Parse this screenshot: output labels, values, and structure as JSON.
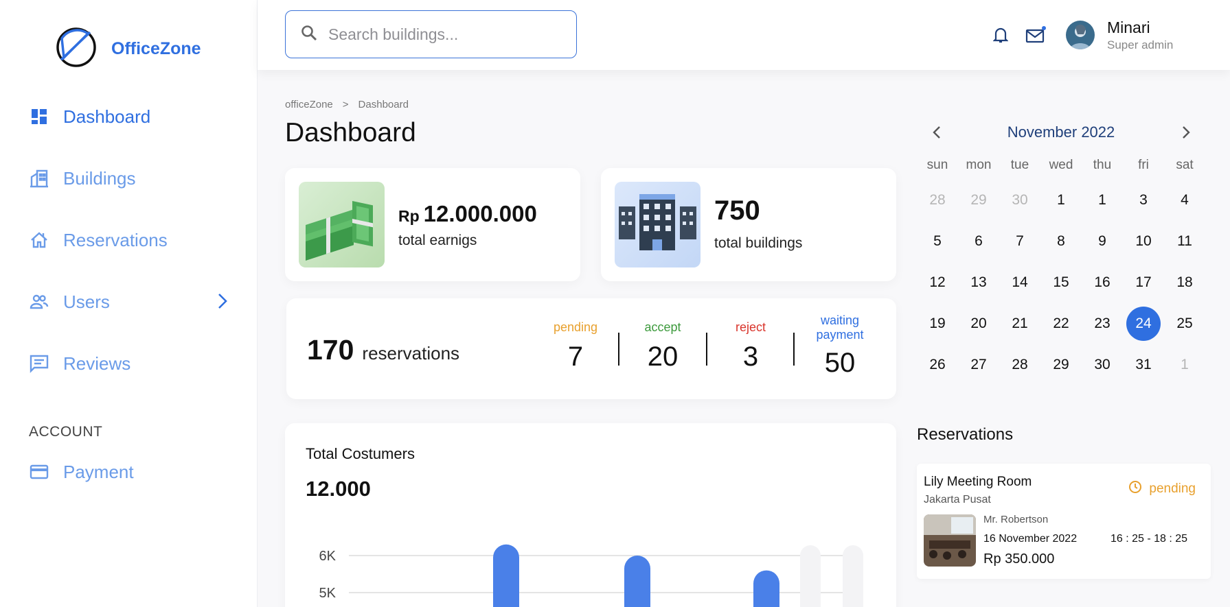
{
  "brand": {
    "name": "OfficeZone"
  },
  "sidebar": {
    "items": [
      {
        "label": "Dashboard",
        "icon": "dashboard-icon"
      },
      {
        "label": "Buildings",
        "icon": "building-icon"
      },
      {
        "label": "Reservations",
        "icon": "house-icon"
      },
      {
        "label": "Users",
        "icon": "users-icon"
      },
      {
        "label": "Reviews",
        "icon": "reviews-icon"
      }
    ],
    "account_title": "ACCOUNT",
    "account_items": [
      {
        "label": "Payment",
        "icon": "card-icon"
      }
    ]
  },
  "search": {
    "placeholder": "Search buildings..."
  },
  "user": {
    "name": "Minari",
    "role": "Super admin"
  },
  "breadcrumb": {
    "root": "officeZone",
    "separator": ">",
    "current": "Dashboard"
  },
  "page": {
    "title": "Dashboard"
  },
  "earnings": {
    "currency": "Rp",
    "value": "12.000.000",
    "label": "total earnigs"
  },
  "buildings": {
    "value": "750",
    "label": "total buildings"
  },
  "reservations_summary": {
    "count": "170",
    "label": "reservations",
    "stats": [
      {
        "label": "pending",
        "value": "7",
        "color": "#e8a02d"
      },
      {
        "label": "accept",
        "value": "20",
        "color": "#3d9a3d"
      },
      {
        "label": "reject",
        "value": "3",
        "color": "#d9342b"
      },
      {
        "label": "waiting payment",
        "value": "50",
        "color": "#2f6fe0"
      }
    ]
  },
  "customers": {
    "title": "Total Costumers",
    "value": "12.000"
  },
  "chart_data": {
    "type": "bar",
    "ylabel": "",
    "yticks": [
      "6K",
      "5K"
    ],
    "values": [
      6.3,
      6.0,
      5.6
    ],
    "placeholder_bars": 2,
    "ylim": [
      4.5,
      6.5
    ],
    "color": "#4a80e8"
  },
  "calendar": {
    "month": "November 2022",
    "weekdays": [
      "sun",
      "mon",
      "tue",
      "wed",
      "thu",
      "fri",
      "sat"
    ],
    "weeks": [
      [
        [
          "28",
          1
        ],
        [
          "29",
          1
        ],
        [
          "30",
          1
        ],
        [
          "1",
          0
        ],
        [
          "1",
          0
        ],
        [
          "3",
          0
        ],
        [
          "4",
          0
        ]
      ],
      [
        [
          "5",
          0
        ],
        [
          "6",
          0
        ],
        [
          "7",
          0
        ],
        [
          "8",
          0
        ],
        [
          "9",
          0
        ],
        [
          "10",
          0
        ],
        [
          "11",
          0
        ]
      ],
      [
        [
          "12",
          0
        ],
        [
          "13",
          0
        ],
        [
          "14",
          0
        ],
        [
          "15",
          0
        ],
        [
          "16",
          0
        ],
        [
          "17",
          0
        ],
        [
          "18",
          0
        ]
      ],
      [
        [
          "19",
          0
        ],
        [
          "20",
          0
        ],
        [
          "21",
          0
        ],
        [
          "22",
          0
        ],
        [
          "23",
          0
        ],
        [
          "24",
          2
        ],
        [
          "25",
          0
        ]
      ],
      [
        [
          "26",
          0
        ],
        [
          "27",
          0
        ],
        [
          "28",
          0
        ],
        [
          "29",
          0
        ],
        [
          "30",
          0
        ],
        [
          "31",
          0
        ],
        [
          "1",
          1
        ]
      ]
    ]
  },
  "reservation_list": {
    "title": "Reservations",
    "items": [
      {
        "room": "Lily Meeting Room",
        "city": "Jakarta Pusat",
        "status": "pending",
        "person": "Mr. Robertson",
        "date": "16 November 2022",
        "time": "16 : 25 - 18 : 25",
        "price": "Rp 350.000"
      }
    ]
  }
}
